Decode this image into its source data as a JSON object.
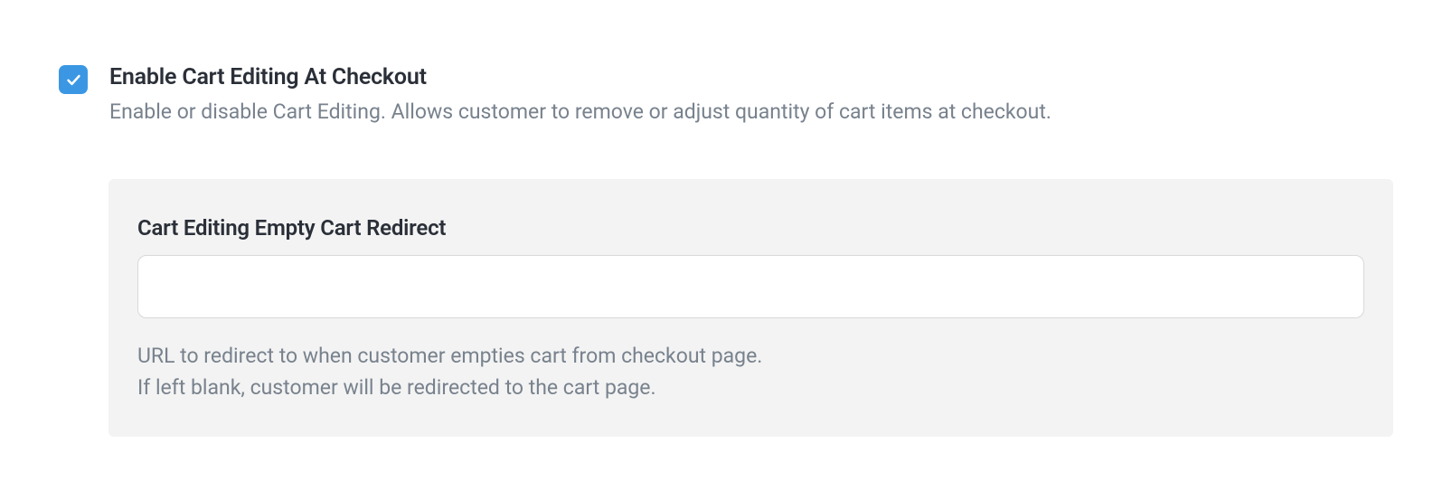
{
  "setting": {
    "title": "Enable Cart Editing At Checkout",
    "description": "Enable or disable Cart Editing. Allows customer to remove or adjust quantity of cart items at checkout.",
    "checked": true
  },
  "panel": {
    "label": "Cart Editing Empty Cart Redirect",
    "input_value": "",
    "help_line1": "URL to redirect to when customer empties cart from checkout page.",
    "help_line2": "If left blank, customer will be redirected to the cart page."
  }
}
